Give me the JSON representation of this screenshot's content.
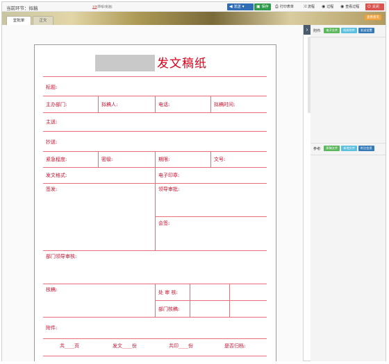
{
  "topbar": {
    "stage_label": "当前环节：拟稿",
    "page_current": "1/2",
    "page_suffix": "(审核/发送)",
    "buttons": {
      "send": "发送",
      "save": "保存",
      "print": "打印表单",
      "flow": "流程",
      "process": "过程",
      "view_process": "查看过程",
      "close": "关闭"
    }
  },
  "tabs": {
    "approve": "呈批单",
    "body": "正文"
  },
  "banner_button": "查看意见",
  "form": {
    "title": "发文稿纸",
    "subject": "标题:",
    "host_dept": "主办部门:",
    "drafter": "拟稿人:",
    "phone": "电话:",
    "draft_time": "拟稿时间:",
    "send_to": "主送:",
    "copy_to": "抄送:",
    "urgency": "紧急程度:",
    "secret_level": "密级:",
    "deadline": "期限:",
    "doc_number": "文号:",
    "doc_format": "发文格式:",
    "e_seal": "电子印章:",
    "issue": "签发:",
    "leader_approval": "领导审批:",
    "countersign": "会签:",
    "dept_leader_review": "部门领导审核:",
    "verify": "核稿:",
    "office_review": "处 审 核:",
    "dept_verify": "部门核稿:",
    "attachment": "附件:",
    "footer": {
      "total_pages": "共____页",
      "copies": "发文____份",
      "printed": "共印____份",
      "archive": "是否归档:"
    }
  },
  "side": {
    "attach_label": "附件:",
    "attach_buttons": [
      "电子文件",
      "纸质附件",
      "发送设置"
    ],
    "ref_label": "参考:",
    "ref_buttons": [
      "原稿文件",
      "本地文件",
      "附注信息"
    ]
  }
}
